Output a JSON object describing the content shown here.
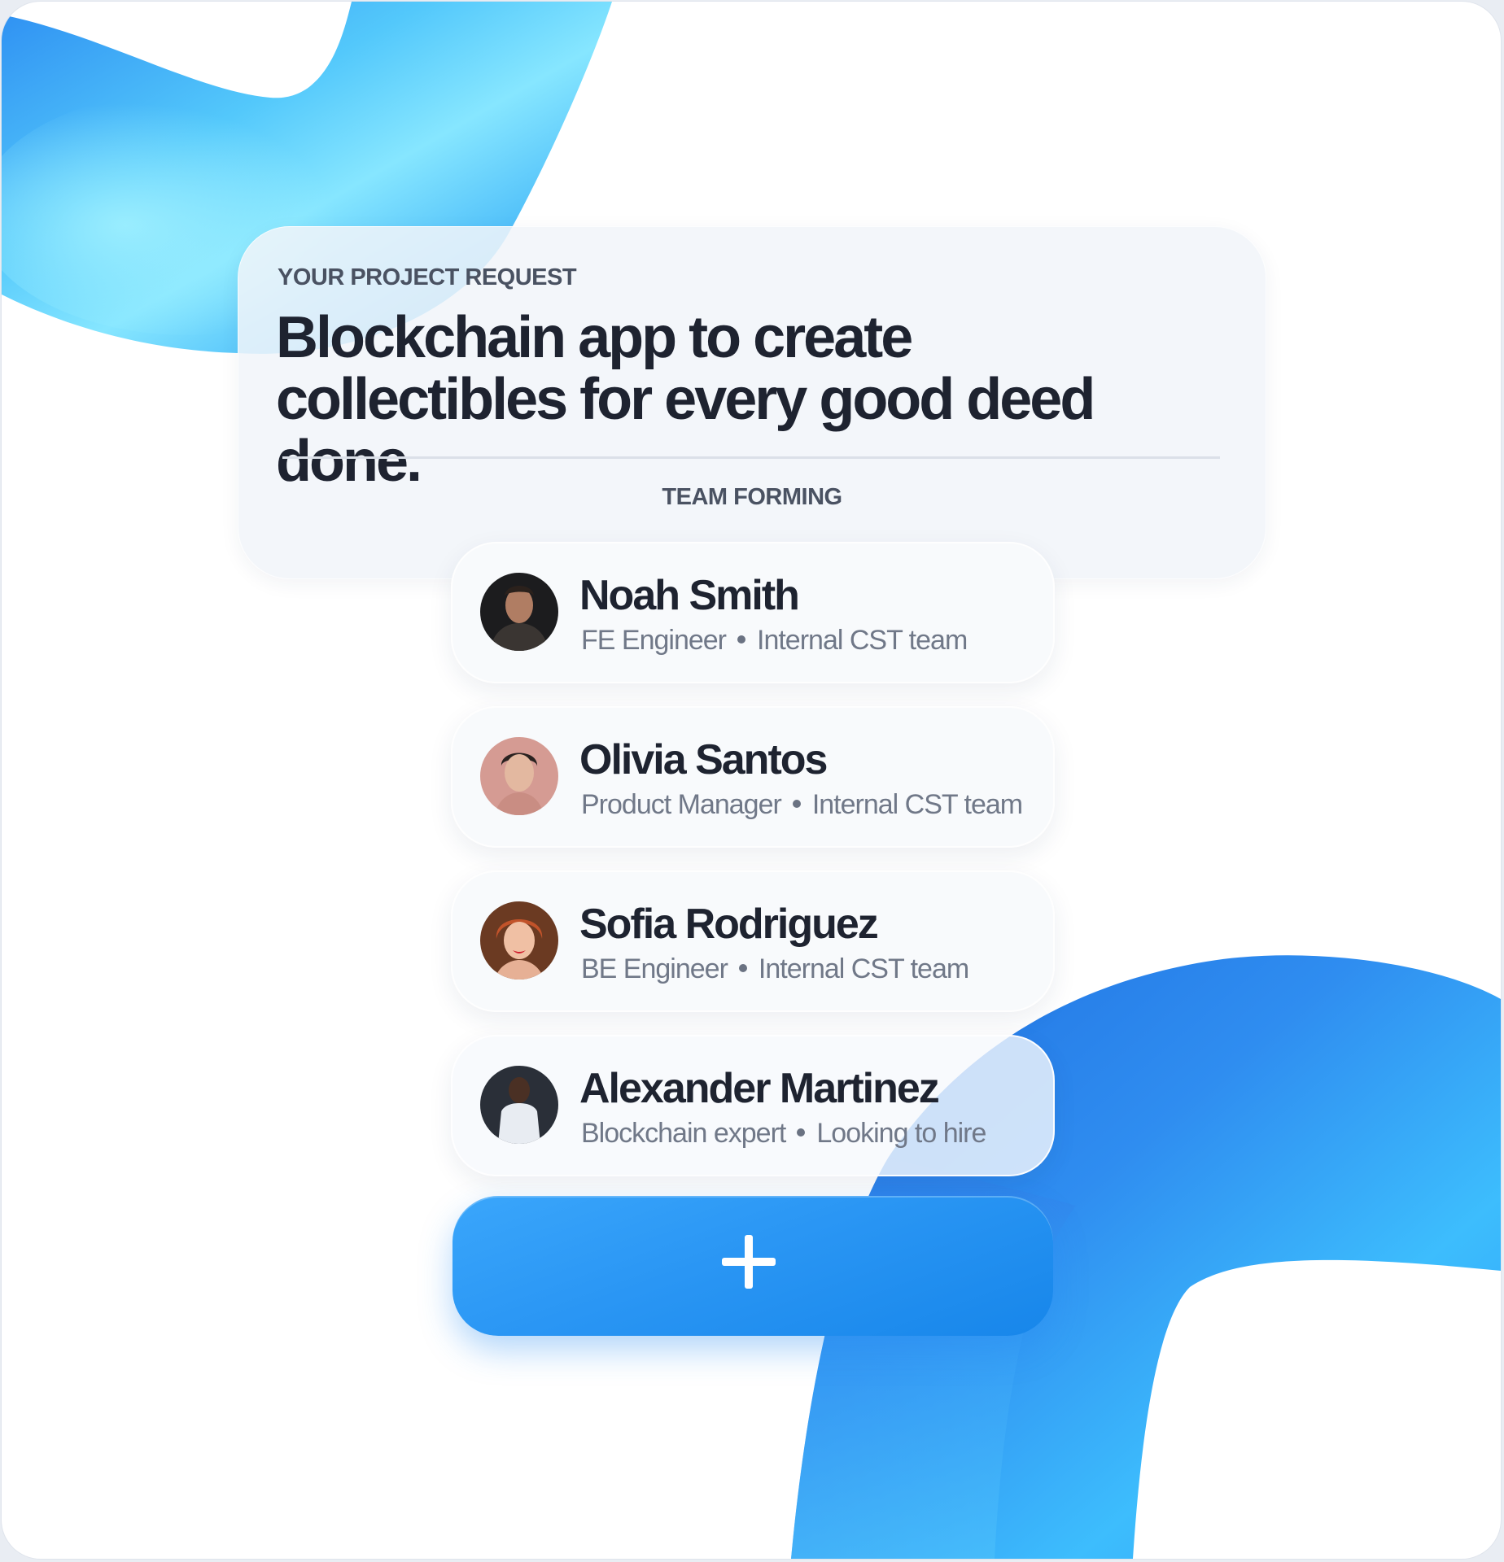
{
  "project": {
    "eyebrow": "YOUR PROJECT REQUEST",
    "title": "Blockchain app to create collectibles for every good deed done.",
    "section_label": "TEAM FORMING"
  },
  "team": [
    {
      "name": "Noah Smith",
      "role": "FE Engineer",
      "source": "Internal CST team",
      "avatar": "avatar-photo"
    },
    {
      "name": "Olivia Santos",
      "role": "Product Manager",
      "source": "Internal CST team",
      "avatar": "avatar-photo"
    },
    {
      "name": "Sofia Rodriguez",
      "role": "BE Engineer",
      "source": "Internal CST team",
      "avatar": "avatar-photo"
    },
    {
      "name": "Alexander Martinez",
      "role": "Blockchain expert",
      "source": "Looking to hire",
      "avatar": "avatar-photo"
    }
  ],
  "add_button": {
    "icon": "plus-icon"
  },
  "colors": {
    "accent": "#2a96f4",
    "accent_light": "#5fd0ff",
    "text_primary": "#1e2330",
    "text_secondary": "#707888",
    "card_bg": "#f1f4f9"
  }
}
